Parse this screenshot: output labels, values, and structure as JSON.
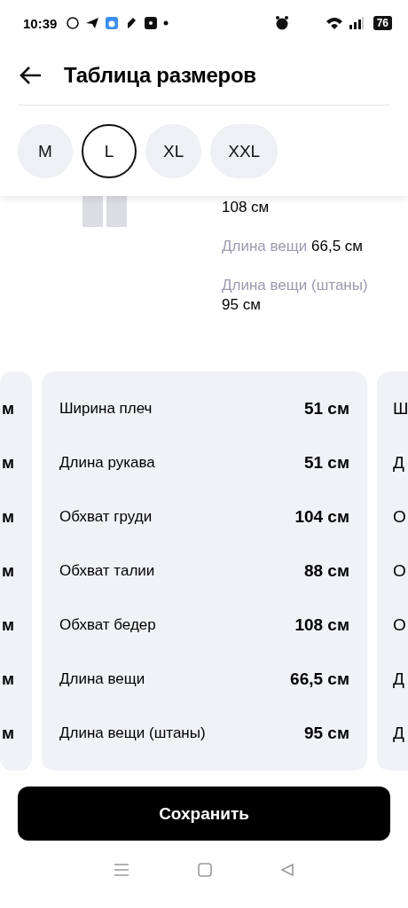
{
  "status_bar": {
    "time": "10:39",
    "battery": "76"
  },
  "header": {
    "title": "Таблица размеров"
  },
  "sizes": [
    {
      "label": "M",
      "selected": false
    },
    {
      "label": "L",
      "selected": true
    },
    {
      "label": "XL",
      "selected": false
    },
    {
      "label": "XXL",
      "selected": false
    }
  ],
  "summary": [
    {
      "value": "108 см"
    },
    {
      "label": "Длина вещи",
      "value": "66,5 см"
    },
    {
      "label": "Длина вещи (штаны)",
      "value": "95 см"
    }
  ],
  "previous_card": [
    "м",
    "м",
    "м",
    "м",
    "м",
    "м",
    "м"
  ],
  "measurements": [
    {
      "label": "Ширина плеч",
      "value": "51 см"
    },
    {
      "label": "Длина рукава",
      "value": "51 см"
    },
    {
      "label": "Обхват груди",
      "value": "104 см"
    },
    {
      "label": "Обхват талии",
      "value": "88 см"
    },
    {
      "label": "Обхват бедер",
      "value": "108 см"
    },
    {
      "label": "Длина вещи",
      "value": "66,5 см"
    },
    {
      "label": "Длина вещи (штаны)",
      "value": "95 см"
    }
  ],
  "next_card": [
    "Ш",
    "Д",
    "О",
    "О",
    "О",
    "Д",
    "Д"
  ],
  "save_button": "Сохранить"
}
